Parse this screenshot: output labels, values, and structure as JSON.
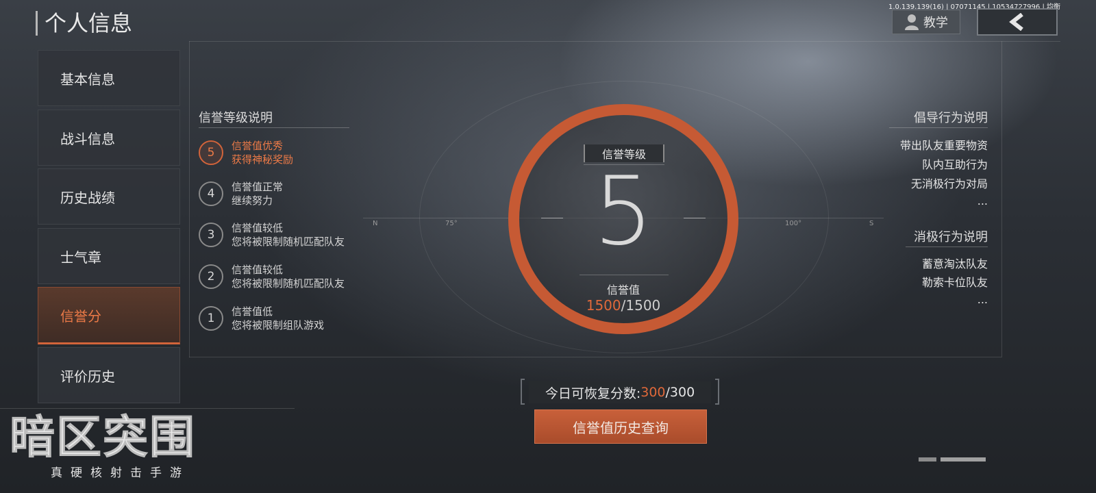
{
  "header": {
    "title": "个人信息",
    "build_info": "1.0.139.139(16) | 07071145 | 10534727996 | 均衡",
    "tutorial_label": "教学"
  },
  "sidebar": {
    "items": [
      {
        "label": "基本信息"
      },
      {
        "label": "战斗信息"
      },
      {
        "label": "历史战绩"
      },
      {
        "label": "士气章"
      },
      {
        "label": "信誉分"
      },
      {
        "label": "评价历史"
      }
    ],
    "active_index": 4
  },
  "levels": {
    "title": "信誉等级说明",
    "items": [
      {
        "level": "5",
        "line1": "信誉值优秀",
        "line2": "获得神秘奖励",
        "active": true
      },
      {
        "level": "4",
        "line1": "信誉值正常",
        "line2": "继续努力"
      },
      {
        "level": "3",
        "line1": "信誉值较低",
        "line2": "您将被限制随机匹配队友"
      },
      {
        "level": "2",
        "line1": "信誉值较低",
        "line2": "您将被限制随机匹配队友"
      },
      {
        "level": "1",
        "line1": "信誉值低",
        "line2": "您将被限制组队游戏"
      }
    ]
  },
  "center": {
    "grade_label": "信誉等级",
    "grade_value": "5",
    "score_label": "信誉值",
    "score_current": "1500",
    "score_max": "/1500",
    "compass": {
      "n": "N",
      "deg75": "75°",
      "deg100": "100°",
      "s": "S"
    }
  },
  "encouraged": {
    "title": "倡导行为说明",
    "items": [
      "带出队友重要物资",
      "队内互助行为",
      "无消极行为对局",
      "..."
    ]
  },
  "negative": {
    "title": "消极行为说明",
    "items": [
      "蓄意淘汰队友",
      "勒索卡位队友",
      "..."
    ]
  },
  "bottom": {
    "recover_prefix": "今日可恢复分数:",
    "recover_current": "300",
    "recover_max": "/300",
    "history_button": "信誉值历史查询"
  },
  "logo": {
    "main": "暗区突围",
    "sub": "真硬核射击手游"
  },
  "colors": {
    "accent": "#d2643a",
    "accent_text": "#ec7a47"
  },
  "icons": {
    "tutorial": "user-icon",
    "back": "chevron-left-icon"
  }
}
